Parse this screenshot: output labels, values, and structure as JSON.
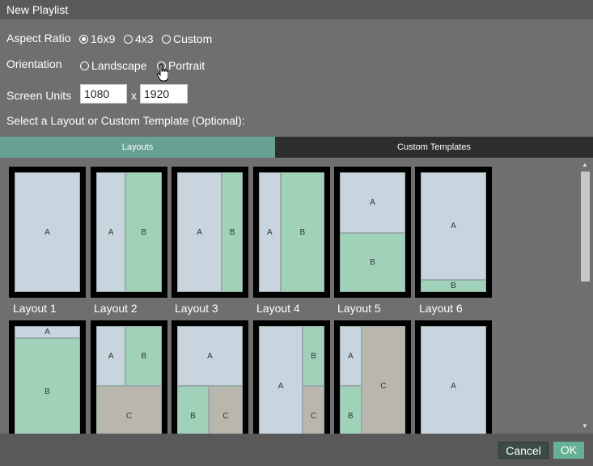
{
  "dialog": {
    "title": "New Playlist"
  },
  "aspect_ratio": {
    "label": "Aspect Ratio",
    "options": [
      {
        "label": "16x9",
        "checked": true
      },
      {
        "label": "4x3",
        "checked": false
      },
      {
        "label": "Custom",
        "checked": false
      }
    ]
  },
  "orientation": {
    "label": "Orientation",
    "options": [
      {
        "label": "Landscape",
        "checked": false
      },
      {
        "label": "Portrait",
        "checked": false
      }
    ]
  },
  "screen_units": {
    "label": "Screen Units",
    "width_value": "1080",
    "separator": "x",
    "height_value": "1920"
  },
  "section_label": "Select a Layout or Custom Template (Optional):",
  "tabs": [
    {
      "label": "Layouts",
      "active": true
    },
    {
      "label": "Custom Templates",
      "active": false
    }
  ],
  "layouts_row1": [
    {
      "label": "Layout 1",
      "regions": [
        "A"
      ]
    },
    {
      "label": "Layout 2",
      "regions": [
        "A",
        "B"
      ]
    },
    {
      "label": "Layout 3",
      "regions": [
        "A",
        "B"
      ]
    },
    {
      "label": "Layout 4",
      "regions": [
        "A",
        "B"
      ]
    },
    {
      "label": "Layout 5",
      "regions": [
        "A",
        "B"
      ]
    },
    {
      "label": "Layout 6",
      "regions": [
        "A",
        "B"
      ]
    }
  ],
  "layouts_row2": [
    {
      "regions": [
        "A",
        "B"
      ]
    },
    {
      "regions": [
        "A",
        "B",
        "C"
      ]
    },
    {
      "regions": [
        "A",
        "B",
        "C"
      ]
    },
    {
      "regions": [
        "A",
        "B",
        "C"
      ]
    },
    {
      "regions": [
        "A",
        "B",
        "C"
      ]
    },
    {
      "regions": [
        "A"
      ]
    }
  ],
  "footer": {
    "cancel_label": "Cancel",
    "ok_label": "OK"
  },
  "colors": {
    "region_blue": "#c9d5de",
    "region_green": "#9fd2b9",
    "region_gray": "#b8b6ad",
    "tab_active": "#67a193",
    "ok_button": "#66b094"
  }
}
